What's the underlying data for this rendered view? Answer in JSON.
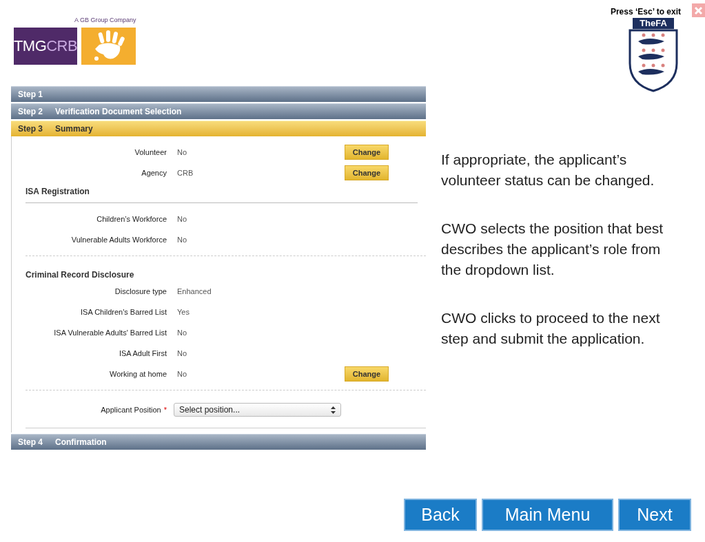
{
  "header": {
    "tagline": "A GB Group Company",
    "logo_text_1": "TMG",
    "logo_text_2": "CRB",
    "exit_hint": "Press ‘Esc’ to exit",
    "crest_title": "TheFA"
  },
  "steps": [
    {
      "number": "Step 1",
      "selected": false
    },
    {
      "number": "Step 2",
      "title": "Verification Document Selection",
      "selected": false
    },
    {
      "number": "Step 3",
      "title": "Summary",
      "selected": true
    },
    {
      "number": "Step 4",
      "title": "Confirmation",
      "selected": false
    }
  ],
  "summary": {
    "top_rows": [
      {
        "label": "Volunteer",
        "value": "No",
        "action": "Change"
      },
      {
        "label": "Agency",
        "value": "CRB",
        "action": "Change"
      }
    ],
    "sections": [
      {
        "title": "ISA Registration",
        "underlined": true,
        "rows": [
          {
            "label": "Children’s Workforce",
            "value": "No"
          },
          {
            "label": "Vulnerable Adults Workforce",
            "value": "No"
          }
        ]
      },
      {
        "title": "Criminal Record Disclosure",
        "underlined": false,
        "rows": [
          {
            "label": "Disclosure type",
            "value": "Enhanced"
          },
          {
            "label": "ISA Children's Barred List",
            "value": "Yes"
          },
          {
            "label": "ISA Vulnerable Adults' Barred List",
            "value": "No"
          },
          {
            "label": "ISA Adult First",
            "value": "No"
          },
          {
            "label": "Working at home",
            "value": "No",
            "action": "Change"
          }
        ]
      }
    ],
    "position": {
      "label": "Applicant Position",
      "required_mark": "*",
      "value": "Select position..."
    }
  },
  "notes": [
    "If appropriate, the applicant’s volunteer status can be changed.",
    "CWO selects the position that best describes the applicant’s role from the dropdown list.",
    "CWO clicks to proceed to the next step and submit the application."
  ],
  "nav_buttons": [
    "Back",
    "Main Menu",
    "Next"
  ]
}
